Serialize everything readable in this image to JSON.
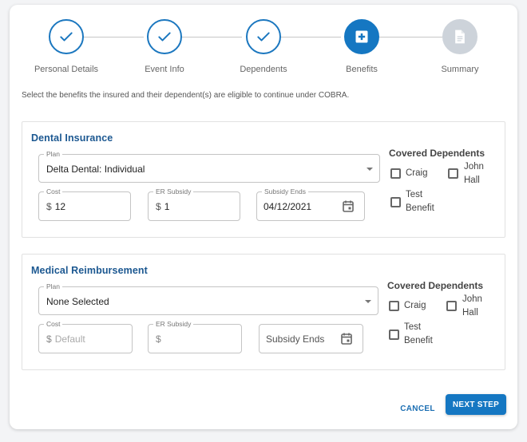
{
  "stepper": {
    "steps": [
      {
        "label": "Personal Details",
        "status": "complete",
        "icon": "check-icon"
      },
      {
        "label": "Event Info",
        "status": "complete",
        "icon": "check-icon"
      },
      {
        "label": "Dependents",
        "status": "complete",
        "icon": "check-icon"
      },
      {
        "label": "Benefits",
        "status": "active",
        "icon": "medical-plus-icon"
      },
      {
        "label": "Summary",
        "status": "pending",
        "icon": "document-icon"
      }
    ]
  },
  "intro_text": "Select the benefits the insured and their dependent(s) are eligible to continue under COBRA.",
  "sections": [
    {
      "title": "Dental Insurance",
      "plan": {
        "label": "Plan",
        "value": "Delta Dental: Individual"
      },
      "cost": {
        "label": "Cost",
        "prefix": "$",
        "value": "12"
      },
      "er_subsidy": {
        "label": "ER Subsidy",
        "prefix": "$",
        "value": "1"
      },
      "subsidy_ends": {
        "label": "Subsidy Ends",
        "value": "04/12/2021"
      },
      "covered_title": "Covered Dependents",
      "dependents": [
        {
          "first": "Craig",
          "last": ""
        },
        {
          "first": "John",
          "last": "Hall"
        },
        {
          "first": "Test",
          "last": "Benefit"
        }
      ]
    },
    {
      "title": "Medical Reimbursement",
      "plan": {
        "label": "Plan",
        "value": "None Selected"
      },
      "cost": {
        "label": "Cost",
        "prefix": "$",
        "placeholder": "Default"
      },
      "er_subsidy": {
        "label": "ER Subsidy",
        "prefix": "$",
        "value": ""
      },
      "subsidy_ends": {
        "placeholder": "Subsidy Ends"
      },
      "covered_title": "Covered Dependents",
      "dependents": [
        {
          "first": "Craig",
          "last": ""
        },
        {
          "first": "John",
          "last": "Hall"
        },
        {
          "first": "Test",
          "last": "Benefit"
        }
      ]
    }
  ],
  "actions": {
    "cancel": "CANCEL",
    "next": "NEXT STEP"
  },
  "colors": {
    "primary": "#1577c2",
    "title_blue": "#1c5891",
    "pending_grey": "#cdd3da"
  }
}
